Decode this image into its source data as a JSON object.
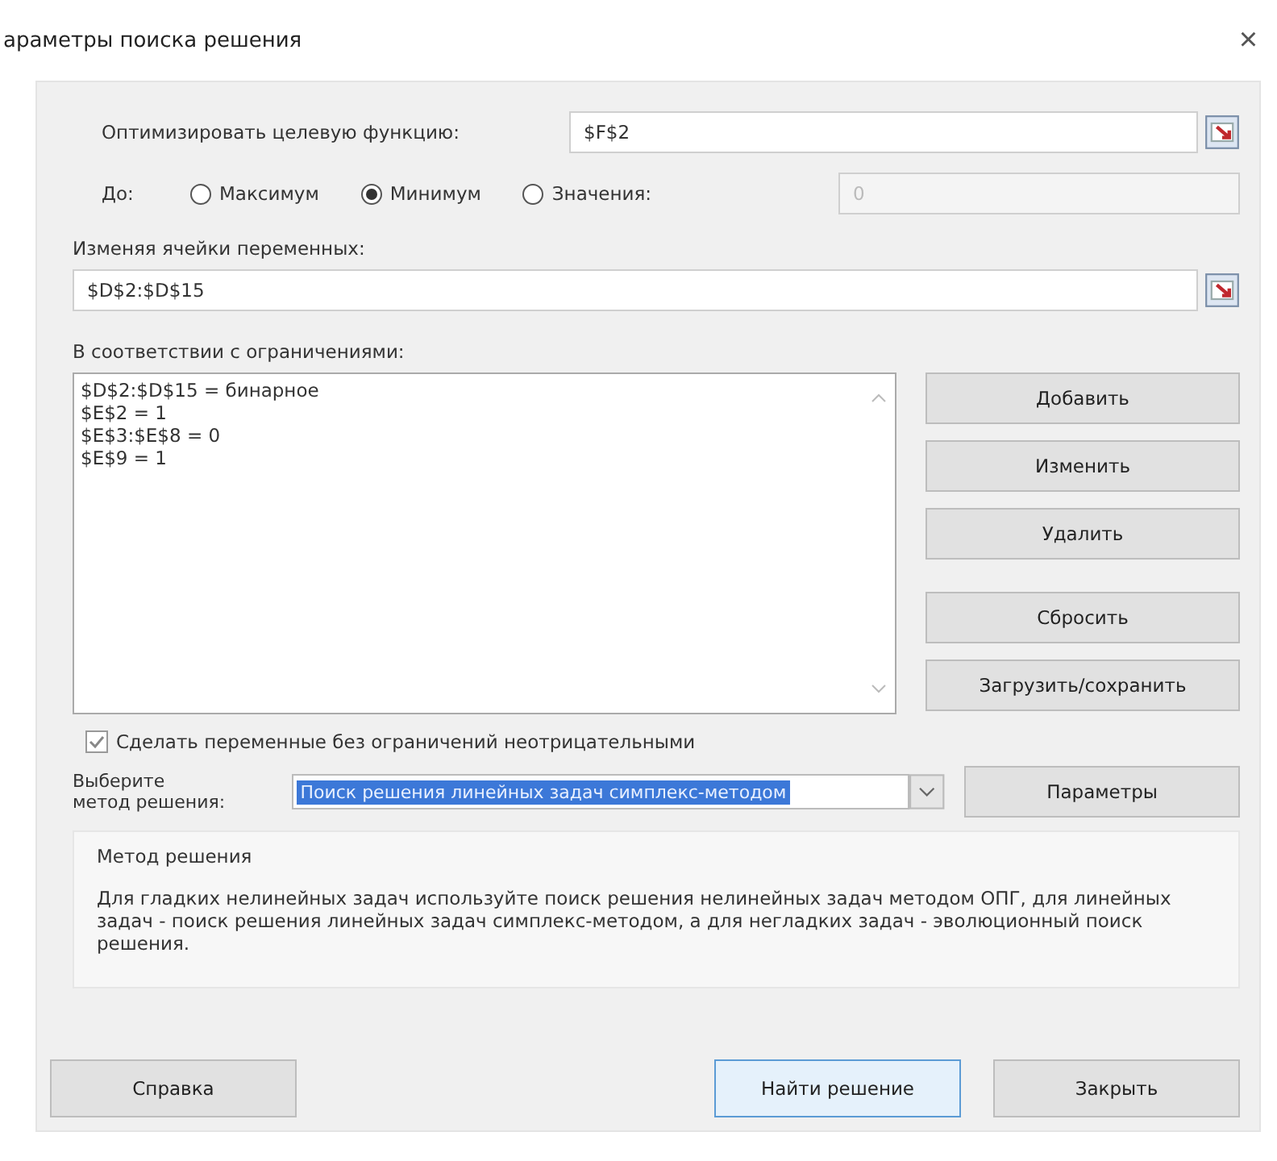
{
  "window": {
    "title": "араметры поиска решения",
    "close": "×"
  },
  "objective": {
    "label": "Оптимизировать целевую функцию:",
    "value": "$F$2"
  },
  "to": {
    "label": "До:",
    "options": [
      {
        "label": "Максимум",
        "selected": false
      },
      {
        "label": "Минимум",
        "selected": true
      },
      {
        "label": "Значения:",
        "selected": false
      }
    ],
    "value_field": {
      "value": "0",
      "disabled": true
    }
  },
  "variables": {
    "label": "Изменяя ячейки переменных:",
    "value": "$D$2:$D$15"
  },
  "constraints": {
    "label": "В соответствии с ограничениями:",
    "items": [
      "$D$2:$D$15 = бинарное",
      "$E$2 = 1",
      "$E$3:$E$8 = 0",
      "$E$9 = 1"
    ],
    "buttons": [
      "Добавить",
      "Изменить",
      "Удалить",
      "Сбросить",
      "Загрузить/сохранить"
    ]
  },
  "nonnegative": {
    "label": "Сделать переменные без ограничений неотрицательными",
    "checked": true
  },
  "method": {
    "label_line1": "Выберите",
    "label_line2": "метод решения:",
    "value": "Поиск решения линейных задач симплекс-методом",
    "button": "Параметры"
  },
  "method_info": {
    "title": "Метод решения",
    "text": "Для гладких нелинейных задач используйте поиск решения нелинейных задач методом ОПГ, для линейных задач - поиск решения линейных задач симплекс-методом, а для негладких задач - эволюционный поиск решения."
  },
  "footer": [
    {
      "label": "Справка",
      "default": false
    },
    {
      "label": "Найти решение",
      "default": true
    },
    {
      "label": "Закрыть",
      "default": false
    }
  ]
}
